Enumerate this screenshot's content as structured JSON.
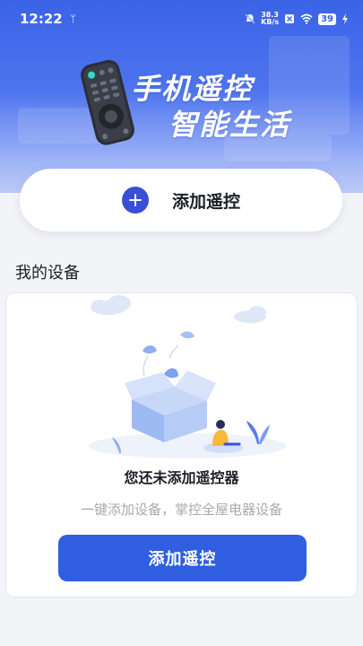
{
  "status_bar": {
    "time": "12:22",
    "net_speed_value": "38.3",
    "net_speed_unit": "KB/s",
    "battery": "39"
  },
  "hero": {
    "title_line1": "手机遥控",
    "title_line2": "智能生活"
  },
  "add_card": {
    "label": "添加遥控"
  },
  "devices": {
    "section_title": "我的设备",
    "empty_title": "您还未添加遥控器",
    "empty_desc": "一键添加设备，掌控全屋电器设备",
    "button_label": "添加遥控"
  },
  "colors": {
    "brand_blue": "#2f5fe0",
    "plus_circle": "#3a4fd8",
    "hero_top": "#3a63e6"
  },
  "icons": [
    "usb-icon",
    "mute-bell-icon",
    "wifi-icon",
    "sim-off-icon",
    "battery-icon",
    "charging-icon",
    "plus-icon"
  ]
}
